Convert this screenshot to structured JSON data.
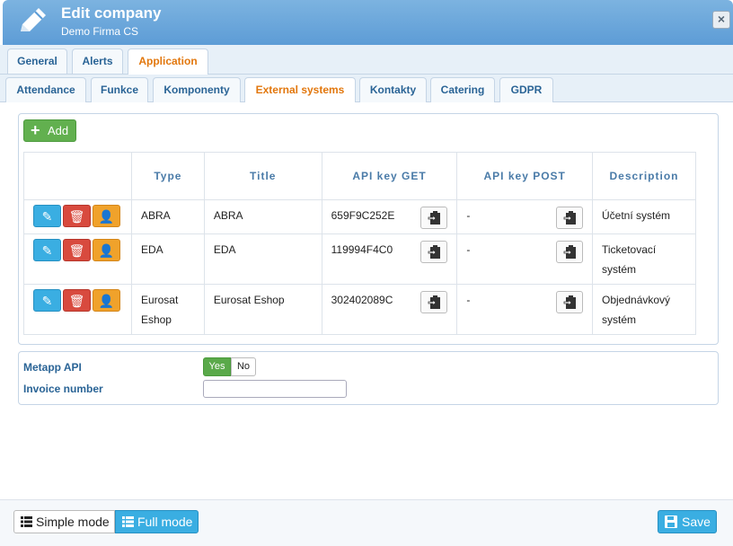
{
  "header": {
    "title": "Edit company",
    "subtitle": "Demo Firma CS",
    "close": "×"
  },
  "tabs_top": [
    {
      "label": "General"
    },
    {
      "label": "Alerts"
    },
    {
      "label": "Application"
    }
  ],
  "tabs_sub": [
    {
      "label": "Attendance"
    },
    {
      "label": "Funkce"
    },
    {
      "label": "Komponenty"
    },
    {
      "label": "External systems"
    },
    {
      "label": "Kontakty"
    },
    {
      "label": "Catering"
    },
    {
      "label": "GDPR"
    }
  ],
  "toolbar": {
    "add_label": "Add"
  },
  "table": {
    "headers": [
      "",
      "Type",
      "Title",
      "API key GET",
      "API key POST",
      "Description"
    ],
    "rows": [
      {
        "type": "ABRA",
        "title": "ABRA",
        "key_get": "659F9C252E",
        "key_post": "-",
        "description": "Účetní systém"
      },
      {
        "type": "EDA",
        "title": "EDA",
        "key_get": "119994F4C0",
        "key_post": "-",
        "description": "Ticketovací systém"
      },
      {
        "type": "Eurosat Eshop",
        "title": "Eurosat Eshop",
        "key_get": "302402089C",
        "key_post": "-",
        "description": "Objednávkový systém"
      }
    ]
  },
  "form": {
    "metapp_label": "Metapp API",
    "yes": "Yes",
    "no": "No",
    "invoice_label": "Invoice number",
    "invoice_value": ""
  },
  "footer": {
    "simple_mode": "Simple mode",
    "full_mode": "Full mode",
    "save": "Save"
  },
  "colors": {
    "header": "#5d9cd6",
    "accent": "#e2770d",
    "primary": "#3aaee2",
    "success": "#62b04f",
    "danger": "#d84a3e",
    "warning": "#f0a22b"
  }
}
